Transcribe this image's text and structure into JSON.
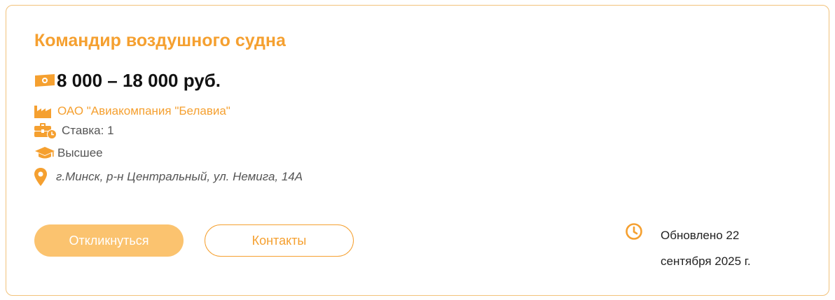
{
  "vacancy": {
    "title": "Командир воздушного судна",
    "salary": "8 000 – 18 000 руб.",
    "company": "ОАО \"Авиакомпания \"Белавиа\"",
    "rate": "Ставка: 1",
    "education": "Высшее",
    "address": "г.Минск, р-н Центральный, ул. Немига, 14А",
    "updated": "Обновлено 22 сентября 2025 г."
  },
  "actions": {
    "apply_label": "Откликнуться",
    "contacts_label": "Контакты"
  },
  "colors": {
    "accent": "#f5a030",
    "apply_button": "#fbc36f",
    "border": "#f2c27a",
    "text_muted": "#555555"
  },
  "icons": {
    "salary": "money-bill-icon",
    "company": "factory-icon",
    "rate": "briefcase-clock-icon",
    "education": "graduation-cap-icon",
    "address": "map-pin-icon",
    "updated": "clock-icon"
  }
}
